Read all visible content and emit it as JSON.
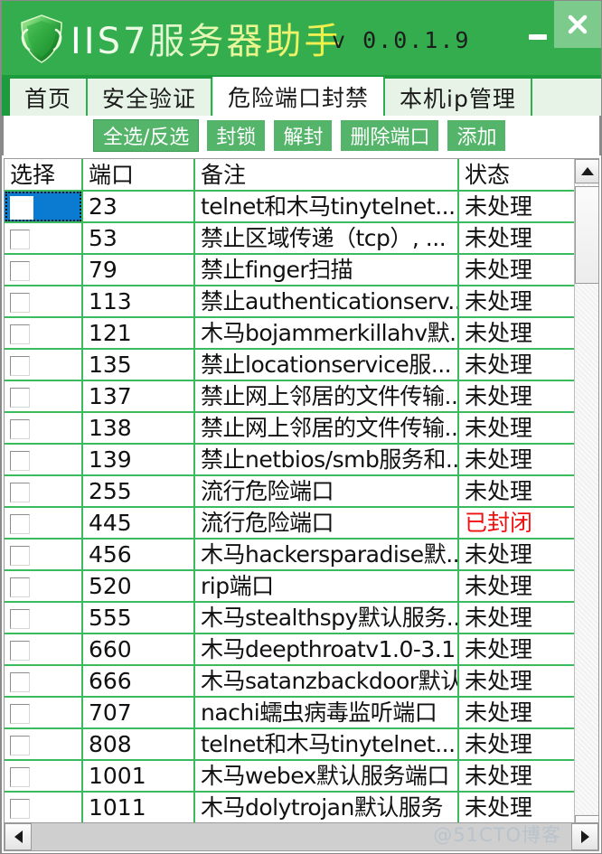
{
  "window": {
    "brand_title": "IIS7服务器助手",
    "version": "v 0.0.1.9",
    "minimize_label": "—",
    "close_label": "✕",
    "logo_icon": "shield-icon"
  },
  "tabs": [
    {
      "label": "首页",
      "active": false
    },
    {
      "label": "安全验证",
      "active": false
    },
    {
      "label": "危险端口封禁",
      "active": true
    },
    {
      "label": "本机ip管理",
      "active": false
    }
  ],
  "toolbar": {
    "buttons": [
      {
        "label": "全选/反选"
      },
      {
        "label": "封锁"
      },
      {
        "label": "解封"
      },
      {
        "label": "删除端口"
      },
      {
        "label": "添加"
      }
    ]
  },
  "table": {
    "columns": [
      "选择",
      "端口",
      "备注",
      "状态"
    ],
    "rows": [
      {
        "port": "23",
        "note": "telnet和木马tinytelnet...",
        "status": "未处理",
        "closed": false,
        "selected": true,
        "checked": false
      },
      {
        "port": "53",
        "note": "禁止区域传递（tcp）, ...",
        "status": "未处理",
        "closed": false,
        "selected": false,
        "checked": false
      },
      {
        "port": "79",
        "note": "禁止finger扫描",
        "status": "未处理",
        "closed": false,
        "selected": false,
        "checked": false
      },
      {
        "port": "113",
        "note": "禁止authenticationserv...",
        "status": "未处理",
        "closed": false,
        "selected": false,
        "checked": false
      },
      {
        "port": "121",
        "note": "木马bojammerkillahv默...",
        "status": "未处理",
        "closed": false,
        "selected": false,
        "checked": false
      },
      {
        "port": "135",
        "note": "禁止locationservice服...",
        "status": "未处理",
        "closed": false,
        "selected": false,
        "checked": false
      },
      {
        "port": "137",
        "note": "禁止网上邻居的文件传输...",
        "status": "未处理",
        "closed": false,
        "selected": false,
        "checked": false
      },
      {
        "port": "138",
        "note": "禁止网上邻居的文件传输...",
        "status": "未处理",
        "closed": false,
        "selected": false,
        "checked": false
      },
      {
        "port": "139",
        "note": "禁止netbios/smb服务和...",
        "status": "未处理",
        "closed": false,
        "selected": false,
        "checked": false
      },
      {
        "port": "255",
        "note": "流行危险端口",
        "status": "未处理",
        "closed": false,
        "selected": false,
        "checked": false
      },
      {
        "port": "445",
        "note": "流行危险端口",
        "status": "已封闭",
        "closed": true,
        "selected": false,
        "checked": false
      },
      {
        "port": "456",
        "note": "木马hackersparadise默...",
        "status": "未处理",
        "closed": false,
        "selected": false,
        "checked": false
      },
      {
        "port": "520",
        "note": "rip端口",
        "status": "未处理",
        "closed": false,
        "selected": false,
        "checked": false
      },
      {
        "port": "555",
        "note": "木马stealthspy默认服务...",
        "status": "未处理",
        "closed": false,
        "selected": false,
        "checked": false
      },
      {
        "port": "660",
        "note": "木马deepthroatv1.0-3.1...",
        "status": "未处理",
        "closed": false,
        "selected": false,
        "checked": false
      },
      {
        "port": "666",
        "note": "木马satanzbackdoor默认...",
        "status": "未处理",
        "closed": false,
        "selected": false,
        "checked": false
      },
      {
        "port": "707",
        "note": "nachi蠕虫病毒监听端口",
        "status": "未处理",
        "closed": false,
        "selected": false,
        "checked": false
      },
      {
        "port": "808",
        "note": "telnet和木马tinytelnet...",
        "status": "未处理",
        "closed": false,
        "selected": false,
        "checked": false
      },
      {
        "port": "1001",
        "note": "木马webex默认服务端口",
        "status": "未处理",
        "closed": false,
        "selected": false,
        "checked": false
      },
      {
        "port": "1011",
        "note": "木马dolytrojan默认服务",
        "status": "未处理",
        "closed": false,
        "selected": false,
        "checked": false
      }
    ]
  },
  "scrollbars": {
    "v_up_icon": "triangle-up-icon",
    "v_down_icon": "triangle-down-icon",
    "h_left_icon": "triangle-left-icon",
    "h_right_icon": "triangle-right-icon"
  },
  "watermark": {
    "text": "@51CTO博客"
  },
  "colors": {
    "title_bg": "#34ad4f",
    "tabstrip_bg": "#1c9c3c",
    "tab_inactive_bg": "#e6f3e6",
    "button_bg": "#54b46a",
    "grid_line": "#3cba5e",
    "status_pending": "#1c1cf0",
    "status_closed": "#f01010",
    "selection_bg": "#0b7ad1"
  }
}
